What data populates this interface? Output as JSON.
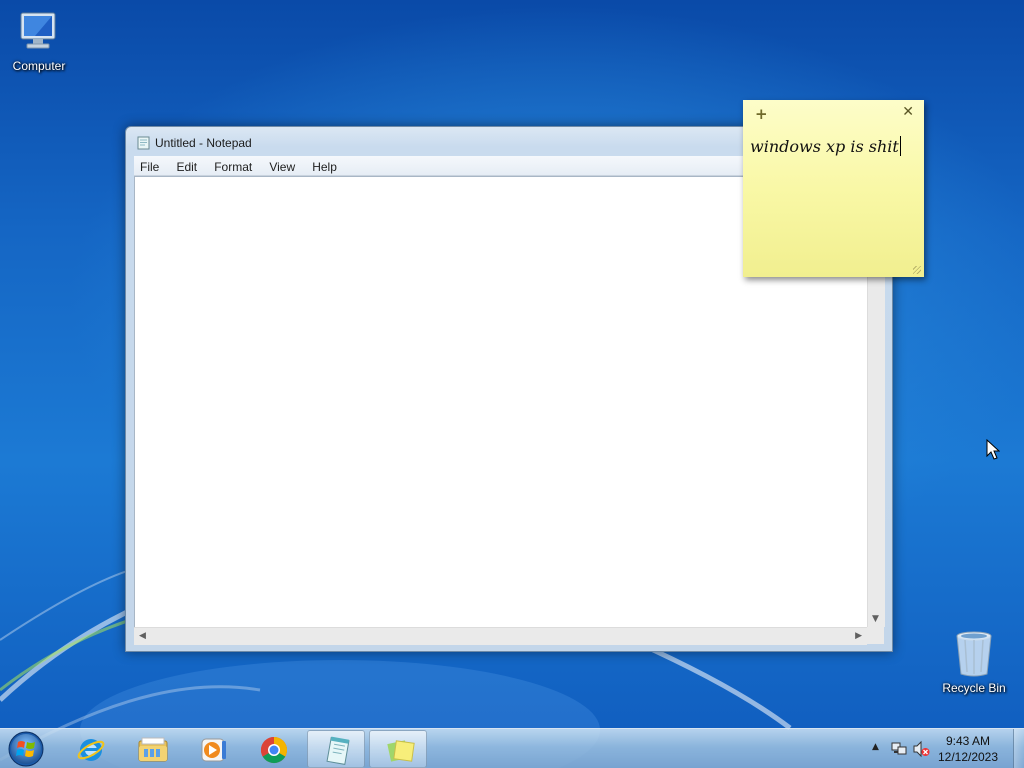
{
  "desktop": {
    "icons": [
      {
        "label": "Computer",
        "icon": "computer-icon"
      },
      {
        "label": "Recycle Bin",
        "icon": "recycle-bin-icon"
      }
    ]
  },
  "notepad": {
    "title": "Untitled - Notepad",
    "menu": [
      "File",
      "Edit",
      "Format",
      "View",
      "Help"
    ],
    "content": ""
  },
  "sticky_note": {
    "text": "windows xp is shit",
    "add_icon": "+",
    "close_icon": "✕"
  },
  "taskbar": {
    "pinned": [
      {
        "name": "Internet Explorer",
        "icon": "internet-explorer-icon"
      },
      {
        "name": "Windows Explorer",
        "icon": "folder-icon"
      },
      {
        "name": "Windows Media Player",
        "icon": "media-player-icon"
      },
      {
        "name": "Google Chrome",
        "icon": "chrome-icon"
      },
      {
        "name": "Notepad",
        "icon": "notepad-icon",
        "active": true
      },
      {
        "name": "Sticky Notes",
        "icon": "sticky-notes-icon",
        "active": true
      }
    ],
    "tray": {
      "time": "9:43 AM",
      "date": "12/12/2023",
      "show_hidden": "▲"
    }
  },
  "colors": {
    "desktop_blue": "#1566c4",
    "sticky_yellow": "#f9f8a6",
    "taskbar": "#a0c3e1"
  }
}
